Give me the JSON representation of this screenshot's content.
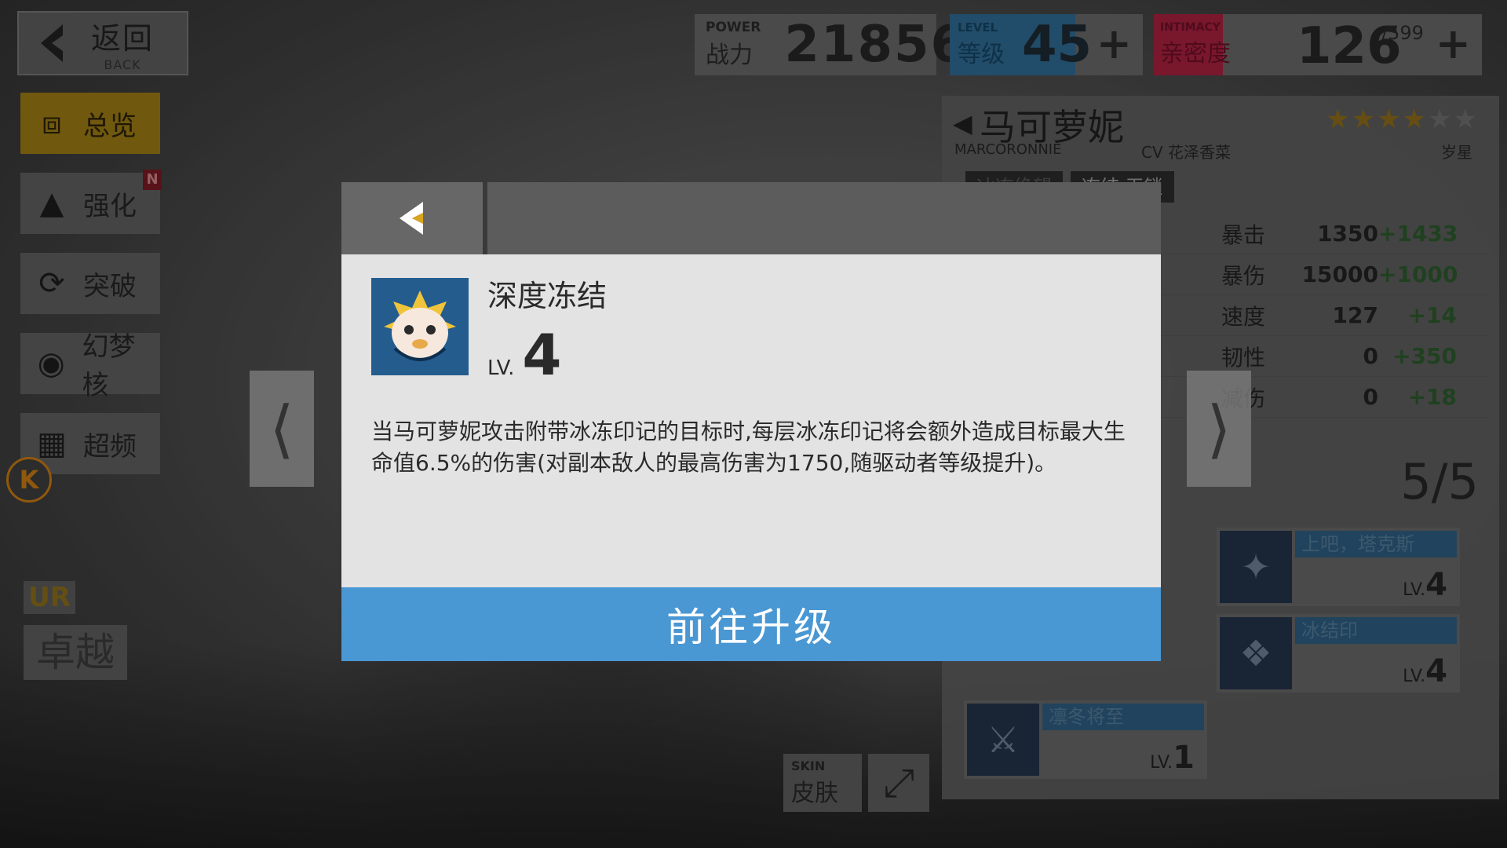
{
  "topbar": {
    "back_cn": "返回",
    "back_en": "BACK",
    "power_en": "POWER",
    "power_cn": "战力",
    "power_value": "21856",
    "level_en": "LEVEL",
    "level_cn": "等级",
    "level_value": "45",
    "level_plus": "+",
    "intimacy_en": "INTIMACY",
    "intimacy_cn": "亲密度",
    "intimacy_value": "126",
    "intimacy_max": "/599",
    "intimacy_plus": "+"
  },
  "sidebar": {
    "items": [
      {
        "label": "总览",
        "icon": "overview-icon",
        "active": true
      },
      {
        "label": "强化",
        "icon": "enhance-icon",
        "badge": "N"
      },
      {
        "label": "突破",
        "icon": "breakthrough-icon"
      },
      {
        "label": "幻梦核",
        "icon": "dream-core-icon"
      },
      {
        "label": "超频",
        "icon": "overclock-icon"
      }
    ],
    "k_badge": "K",
    "rarity": "UR",
    "excellence": "卓越"
  },
  "character": {
    "name": "马可萝妮",
    "name_en": "MARCORONNIE",
    "cv": "CV 花泽香菜",
    "star_label": "岁星",
    "stars_on": 4,
    "stars_total": 6,
    "tags": [
      "冰冻绝望",
      "冻结 无锁"
    ],
    "stats": [
      {
        "label": "暴击",
        "base": "1350",
        "bonus": "+1433"
      },
      {
        "label": "暴伤",
        "base": "15000",
        "bonus": "+1000"
      },
      {
        "label": "速度",
        "base": "127",
        "bonus": "+14"
      },
      {
        "label": "韧性",
        "base": "0",
        "bonus": "+350"
      },
      {
        "label": "减伤",
        "base": "0",
        "bonus": "+18"
      }
    ],
    "skill_count": "5/5",
    "skills": [
      {
        "name": "上吧，塔克斯",
        "lv_prefix": "LV.",
        "lv": "4"
      },
      {
        "name": "冰结印",
        "lv_prefix": "LV.",
        "lv": "4"
      },
      {
        "name": "凛冬将至",
        "lv_prefix": "LV.",
        "lv": "1"
      }
    ]
  },
  "skin": {
    "en": "SKIN",
    "cn": "皮肤"
  },
  "modal": {
    "skill_name": "深度冻结",
    "lv_prefix": "LV.",
    "lv_value": "4",
    "description": "当马可萝妮攻击附带冰冻印记的目标时,每层冰冻印记将会额外造成目标最大生命值6.5%的伤害(对副本敌人的最高伤害为1750,随驱动者等级提升)。",
    "upgrade_button": "前往升级"
  },
  "colors": {
    "upgrade_button": "#4997d3",
    "level_accent": "#2f6a93",
    "intimacy_accent": "#a8203f",
    "sidebar_active": "#9c7a16"
  }
}
